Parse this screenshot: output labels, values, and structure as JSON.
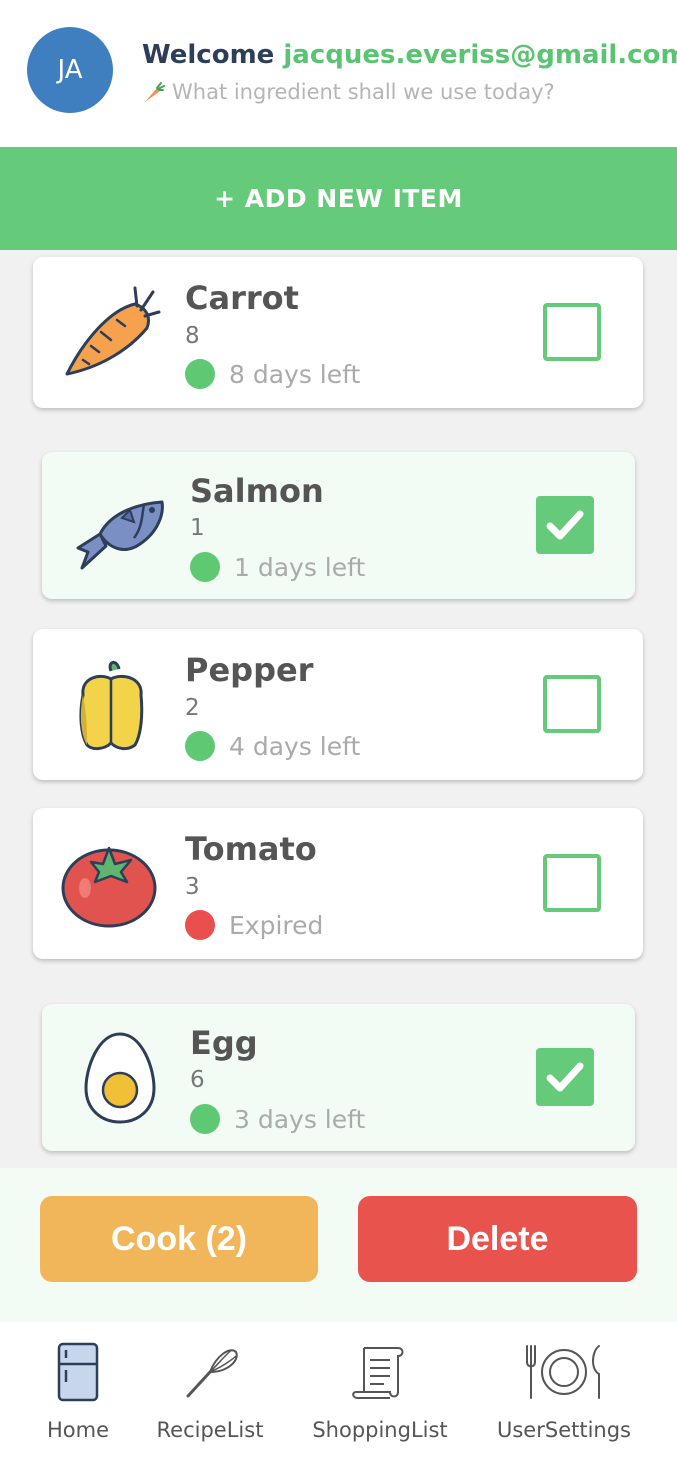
{
  "header": {
    "avatar_initials": "JA",
    "welcome_prefix": "Welcome ",
    "email": "jacques.everiss@gmail.com",
    "subtitle": "What ingredient shall we use today?",
    "subtitle_icon": "carrot-icon"
  },
  "add_button_label": "+ ADD NEW ITEM",
  "items": [
    {
      "name": "Carrot",
      "quantity": "8",
      "status": "8 days left",
      "status_color": "#5fc873",
      "checked": false,
      "icon": "carrot-icon"
    },
    {
      "name": "Salmon",
      "quantity": "1",
      "status": "1 days left",
      "status_color": "#5fc873",
      "checked": true,
      "icon": "fish-icon"
    },
    {
      "name": "Pepper",
      "quantity": "2",
      "status": "4 days left",
      "status_color": "#5fc873",
      "checked": false,
      "icon": "bell-pepper-icon"
    },
    {
      "name": "Tomato",
      "quantity": "3",
      "status": "Expired",
      "status_color": "#e94f4d",
      "checked": false,
      "icon": "tomato-icon"
    },
    {
      "name": "Egg",
      "quantity": "6",
      "status": "3 days left",
      "status_color": "#5fc873",
      "checked": true,
      "icon": "egg-icon"
    }
  ],
  "actions": {
    "cook_label": "Cook (2)",
    "delete_label": "Delete"
  },
  "tabs": [
    {
      "label": "Home",
      "icon": "fridge-icon"
    },
    {
      "label": "RecipeList",
      "icon": "whisk-icon"
    },
    {
      "label": "ShoppingList",
      "icon": "receipt-icon"
    },
    {
      "label": "UserSettings",
      "icon": "plate-cutlery-icon"
    }
  ],
  "colors": {
    "accent_green": "#65ca7a",
    "email_green": "#5bc473",
    "cook_orange": "#f2b65a",
    "delete_red": "#e9534d",
    "avatar_blue": "#3f7fbf"
  }
}
